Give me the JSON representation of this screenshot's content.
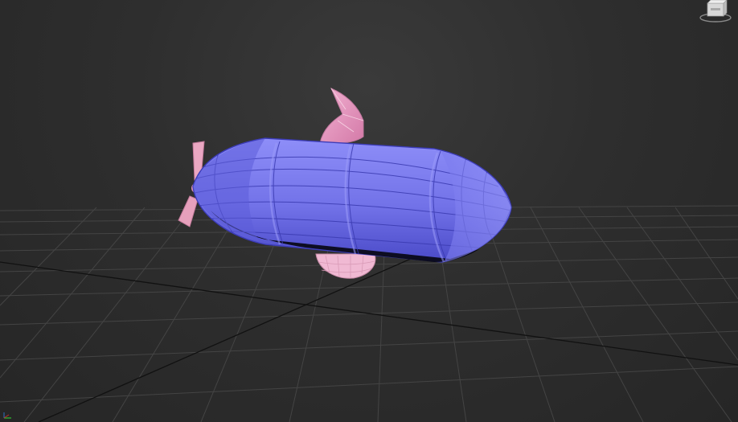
{
  "viewport": {
    "background_color": "#2f2f2f",
    "grid_color": "#4a4a4a",
    "grid_axis_color": "#0e0e0e"
  },
  "viewcube": {
    "label": "",
    "icon": "viewcube-icon"
  },
  "model": {
    "hull_color": "#7b7bf0",
    "hull_edge_color": "#4040c0",
    "fin_color": "#e79ac4",
    "gondola_color": "#efb2cf",
    "propeller_color": "#e7a8c0"
  },
  "axis_tripod": {
    "icon": "axis-tripod-icon"
  }
}
